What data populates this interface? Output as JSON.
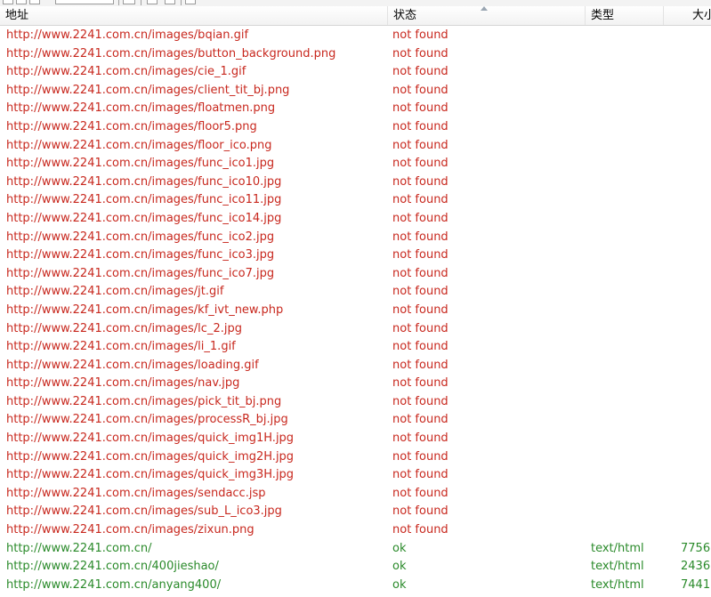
{
  "columns": {
    "address": "地址",
    "status": "状态",
    "type": "类型",
    "size": "大小"
  },
  "colors": {
    "error": "#c8281e",
    "ok": "#2a8a2a"
  },
  "rows": [
    {
      "url": "http://www.2241.com.cn/images/bqian.gif",
      "status": "not found",
      "type": "",
      "size": ""
    },
    {
      "url": "http://www.2241.com.cn/images/button_background.png",
      "status": "not found",
      "type": "",
      "size": ""
    },
    {
      "url": "http://www.2241.com.cn/images/cie_1.gif",
      "status": "not found",
      "type": "",
      "size": ""
    },
    {
      "url": "http://www.2241.com.cn/images/client_tit_bj.png",
      "status": "not found",
      "type": "",
      "size": ""
    },
    {
      "url": "http://www.2241.com.cn/images/floatmen.png",
      "status": "not found",
      "type": "",
      "size": ""
    },
    {
      "url": "http://www.2241.com.cn/images/floor5.png",
      "status": "not found",
      "type": "",
      "size": ""
    },
    {
      "url": "http://www.2241.com.cn/images/floor_ico.png",
      "status": "not found",
      "type": "",
      "size": ""
    },
    {
      "url": "http://www.2241.com.cn/images/func_ico1.jpg",
      "status": "not found",
      "type": "",
      "size": ""
    },
    {
      "url": "http://www.2241.com.cn/images/func_ico10.jpg",
      "status": "not found",
      "type": "",
      "size": ""
    },
    {
      "url": "http://www.2241.com.cn/images/func_ico11.jpg",
      "status": "not found",
      "type": "",
      "size": ""
    },
    {
      "url": "http://www.2241.com.cn/images/func_ico14.jpg",
      "status": "not found",
      "type": "",
      "size": ""
    },
    {
      "url": "http://www.2241.com.cn/images/func_ico2.jpg",
      "status": "not found",
      "type": "",
      "size": ""
    },
    {
      "url": "http://www.2241.com.cn/images/func_ico3.jpg",
      "status": "not found",
      "type": "",
      "size": ""
    },
    {
      "url": "http://www.2241.com.cn/images/func_ico7.jpg",
      "status": "not found",
      "type": "",
      "size": ""
    },
    {
      "url": "http://www.2241.com.cn/images/jt.gif",
      "status": "not found",
      "type": "",
      "size": ""
    },
    {
      "url": "http://www.2241.com.cn/images/kf_ivt_new.php",
      "status": "not found",
      "type": "",
      "size": ""
    },
    {
      "url": "http://www.2241.com.cn/images/lc_2.jpg",
      "status": "not found",
      "type": "",
      "size": ""
    },
    {
      "url": "http://www.2241.com.cn/images/li_1.gif",
      "status": "not found",
      "type": "",
      "size": ""
    },
    {
      "url": "http://www.2241.com.cn/images/loading.gif",
      "status": "not found",
      "type": "",
      "size": ""
    },
    {
      "url": "http://www.2241.com.cn/images/nav.jpg",
      "status": "not found",
      "type": "",
      "size": ""
    },
    {
      "url": "http://www.2241.com.cn/images/pick_tit_bj.png",
      "status": "not found",
      "type": "",
      "size": ""
    },
    {
      "url": "http://www.2241.com.cn/images/processR_bj.jpg",
      "status": "not found",
      "type": "",
      "size": ""
    },
    {
      "url": "http://www.2241.com.cn/images/quick_img1H.jpg",
      "status": "not found",
      "type": "",
      "size": ""
    },
    {
      "url": "http://www.2241.com.cn/images/quick_img2H.jpg",
      "status": "not found",
      "type": "",
      "size": ""
    },
    {
      "url": "http://www.2241.com.cn/images/quick_img3H.jpg",
      "status": "not found",
      "type": "",
      "size": ""
    },
    {
      "url": "http://www.2241.com.cn/images/sendacc.jsp",
      "status": "not found",
      "type": "",
      "size": ""
    },
    {
      "url": "http://www.2241.com.cn/images/sub_L_ico3.jpg",
      "status": "not found",
      "type": "",
      "size": ""
    },
    {
      "url": "http://www.2241.com.cn/images/zixun.png",
      "status": "not found",
      "type": "",
      "size": ""
    },
    {
      "url": "http://www.2241.com.cn/",
      "status": "ok",
      "type": "text/html",
      "size": "7756"
    },
    {
      "url": "http://www.2241.com.cn/400jieshao/",
      "status": "ok",
      "type": "text/html",
      "size": "2436"
    },
    {
      "url": "http://www.2241.com.cn/anyang400/",
      "status": "ok",
      "type": "text/html",
      "size": "7441"
    }
  ]
}
